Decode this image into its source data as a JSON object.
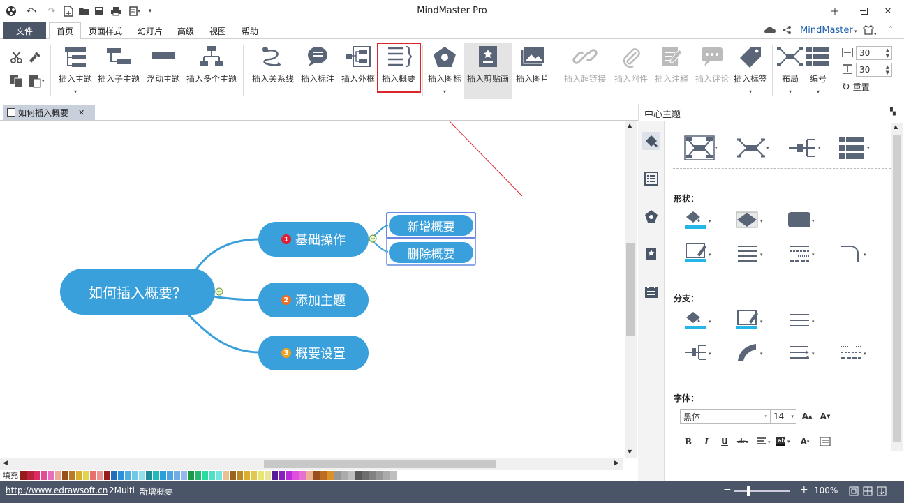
{
  "app": {
    "title": "MindMaster Pro"
  },
  "menu": {
    "file": "文件",
    "tabs": [
      "首页",
      "页面样式",
      "幻灯片",
      "高级",
      "视图",
      "帮助"
    ],
    "user": "MindMaster"
  },
  "ribbon": {
    "insert_topic": "插入主题",
    "insert_subtopic": "插入子主题",
    "floating_topic": "浮动主题",
    "insert_multi": "插入多个主题",
    "insert_relation": "插入关系线",
    "insert_callout": "插入标注",
    "insert_boundary": "插入外框",
    "insert_summary": "插入概要",
    "insert_icon": "插入图标",
    "insert_clipart": "插入剪贴画",
    "insert_image": "插入图片",
    "insert_hyperlink": "插入超链接",
    "insert_attachment": "插入附件",
    "insert_note": "插入注释",
    "insert_comment": "插入评论",
    "insert_tag": "插入标签",
    "layout": "布局",
    "numbering": "编号",
    "spacing_h": "30",
    "spacing_v": "30",
    "reset": "重置"
  },
  "document": {
    "tab": "如何插入概要"
  },
  "mindmap": {
    "root": "如何插入概要？",
    "topics": [
      {
        "label": "基础操作",
        "num": "1",
        "color": "#e02030"
      },
      {
        "label": "添加主题",
        "num": "2",
        "color": "#f07020"
      },
      {
        "label": "概要设置",
        "num": "3",
        "color": "#f0a020"
      }
    ],
    "subtopics": [
      "新增概要",
      "删除概要"
    ]
  },
  "panel": {
    "title": "中心主题",
    "shape": "形状：",
    "branch": "分支：",
    "font": "字体：",
    "font_name": "黑体",
    "font_size": "14"
  },
  "status": {
    "fill": "填充",
    "url": "http://www.edrawsoft.cn",
    "page": "2Multi",
    "action": "新增概要",
    "zoom": "100%"
  }
}
